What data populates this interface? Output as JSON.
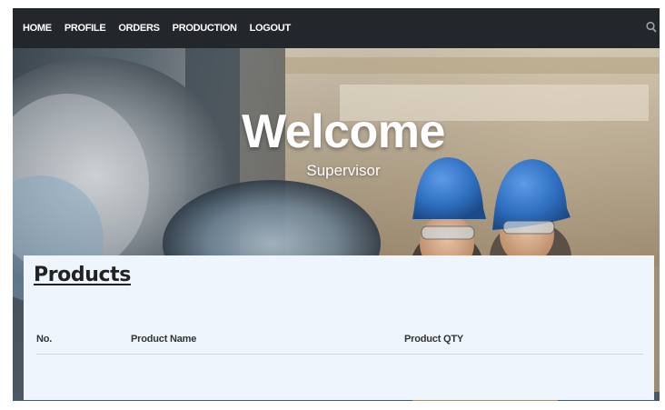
{
  "nav": {
    "links": [
      "HOME",
      "PROFILE",
      "ORDERS",
      "PRODUCTION",
      "LOGOUT"
    ],
    "search_icon": "search-icon"
  },
  "hero": {
    "title": "Welcome",
    "subtitle": "Supervisor"
  },
  "products": {
    "heading": "Products",
    "columns": [
      "No.",
      "Product Name",
      "Product QTY"
    ],
    "rows": []
  },
  "colors": {
    "navbar": "#23272b",
    "panel": "#eef5fc",
    "helmet": "#2f6fc0"
  }
}
